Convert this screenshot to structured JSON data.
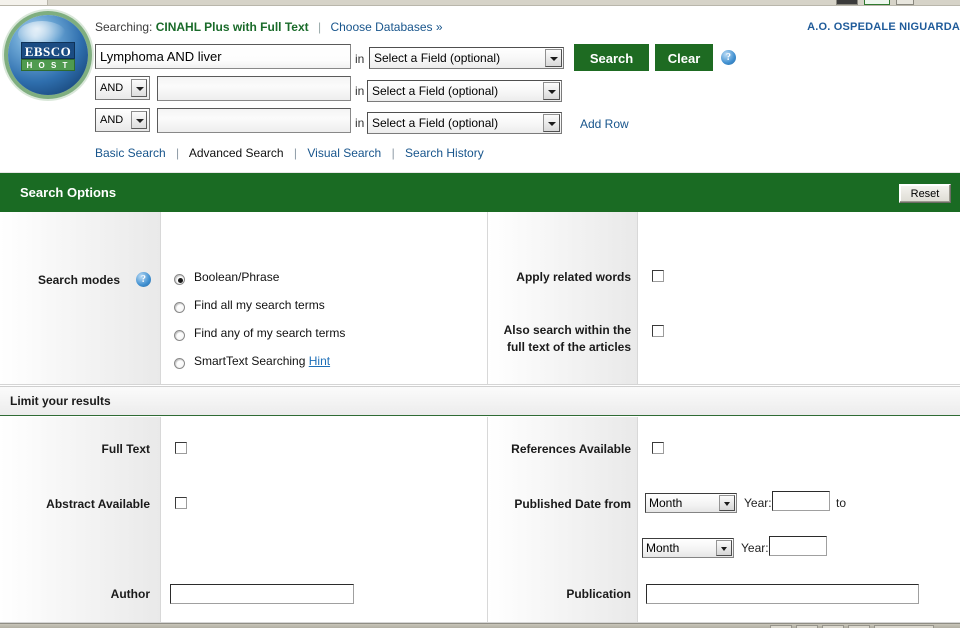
{
  "header": {
    "searching_label": "Searching:",
    "database_name": "CINAHL Plus with Full Text",
    "choose_databases": "Choose Databases »",
    "institution": "A.O. OSPEDALE NIGUARDA",
    "logo_top": "EBSCO",
    "logo_bottom": "H O S T",
    "in_word": "in",
    "add_row": "Add Row",
    "help_icon": "?"
  },
  "search_rows": [
    {
      "boolean": "",
      "term": "Lymphoma AND liver",
      "field": "Select a Field (optional)"
    },
    {
      "boolean": "AND",
      "term": "",
      "field": "Select a Field (optional)"
    },
    {
      "boolean": "AND",
      "term": "",
      "field": "Select a Field (optional)"
    }
  ],
  "buttons": {
    "search": "Search",
    "clear": "Clear",
    "reset": "Reset"
  },
  "nav": {
    "items": [
      {
        "label": "Basic Search",
        "current": false
      },
      {
        "label": "Advanced Search",
        "current": true
      },
      {
        "label": "Visual Search",
        "current": false
      },
      {
        "label": "Search History",
        "current": false
      }
    ],
    "separator": "|"
  },
  "search_options": {
    "title": "Search Options",
    "search_modes_label": "Search modes",
    "modes": [
      {
        "label": "Boolean/Phrase",
        "selected": true,
        "hint": ""
      },
      {
        "label": "Find all my search terms",
        "selected": false,
        "hint": ""
      },
      {
        "label": "Find any of my search terms",
        "selected": false,
        "hint": ""
      },
      {
        "label": "SmartText Searching",
        "selected": false,
        "hint": "Hint"
      }
    ],
    "apply_related_words_label": "Apply related words",
    "apply_related_words_checked": false,
    "also_search_full_text_label": "Also search within the full text of the articles",
    "also_search_full_text_checked": false
  },
  "limit_results": {
    "title": "Limit your results",
    "full_text_label": "Full Text",
    "full_text_checked": false,
    "abstract_available_label": "Abstract Available",
    "abstract_available_checked": false,
    "author_label": "Author",
    "author_value": "",
    "references_available_label": "References Available",
    "references_available_checked": false,
    "published_date_label": "Published Date from",
    "month_from": "Month",
    "year_label_from": "Year:",
    "year_from": "",
    "to_label": "to",
    "month_to": "Month",
    "year_label_to": "Year:",
    "year_to": "",
    "publication_label": "Publication",
    "publication_value": ""
  },
  "colors": {
    "brand_green": "#1a6b23",
    "link_blue": "#18558c",
    "db_green": "#1a6b2a",
    "institution_blue": "#1f5b9a"
  }
}
